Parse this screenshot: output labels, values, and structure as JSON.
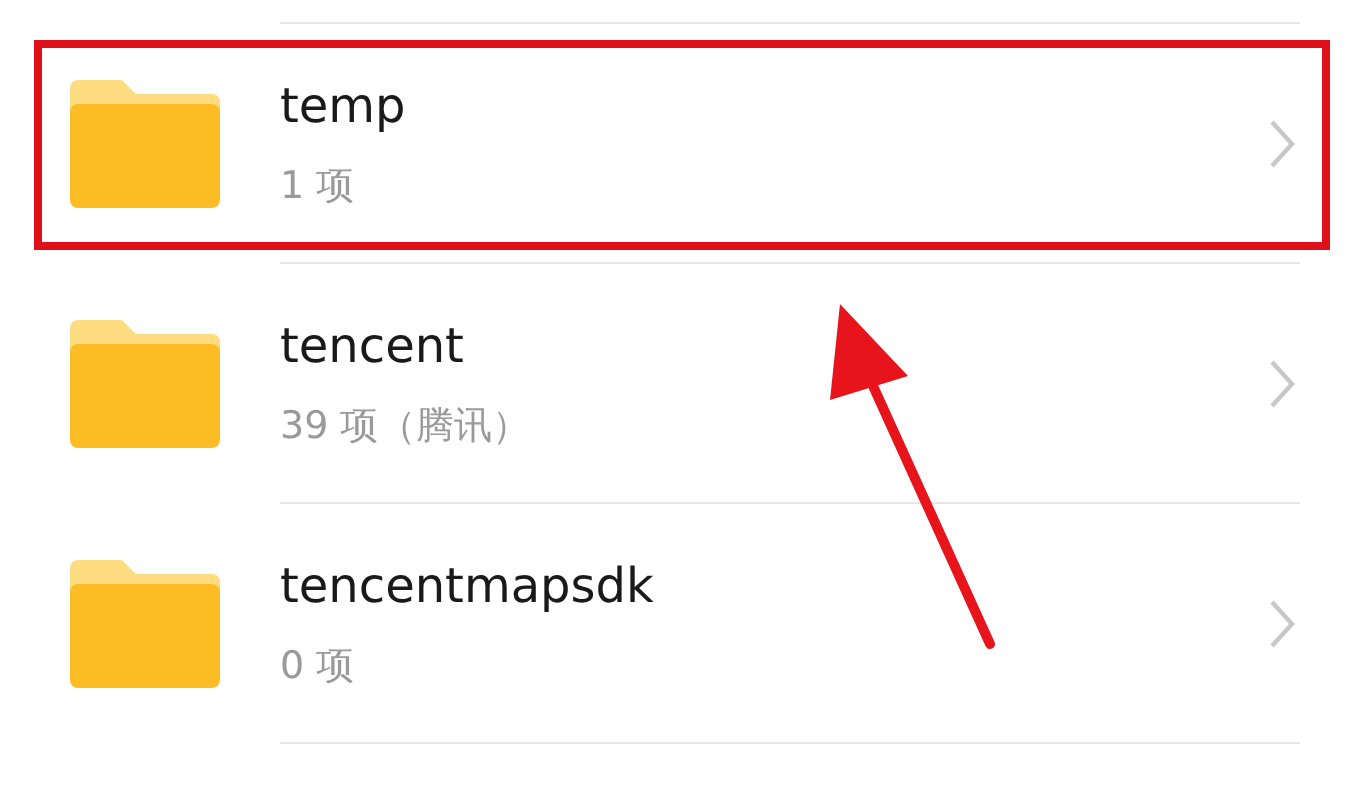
{
  "folders": [
    {
      "name": "temp",
      "details": "1 项",
      "highlighted": true
    },
    {
      "name": "tencent",
      "details": "39 项（腾讯）",
      "highlighted": false
    },
    {
      "name": "tencentmapsdk",
      "details": "0 项",
      "highlighted": false
    }
  ]
}
